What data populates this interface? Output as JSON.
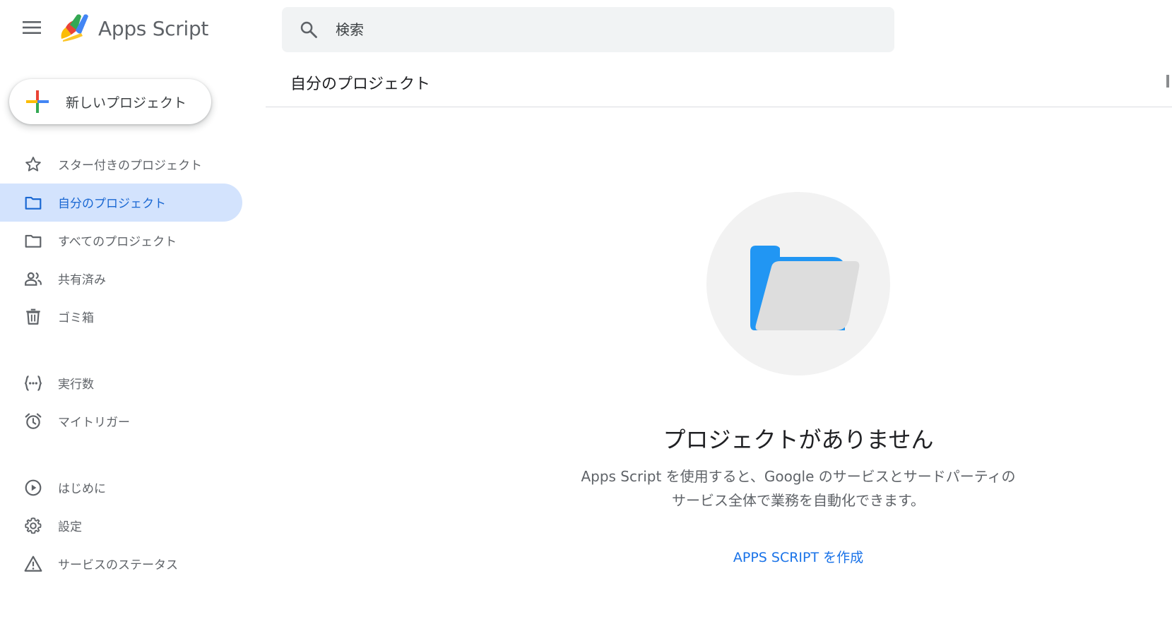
{
  "header": {
    "app_title": "Apps Script",
    "search_placeholder": "検索"
  },
  "new_project": {
    "label": "新しいプロジェクト"
  },
  "sidebar": {
    "items": [
      {
        "label": "スター付きのプロジェクト",
        "icon": "star-icon"
      },
      {
        "label": "自分のプロジェクト",
        "icon": "folder-icon",
        "active": true
      },
      {
        "label": "すべてのプロジェクト",
        "icon": "folder-icon"
      },
      {
        "label": "共有済み",
        "icon": "people-icon"
      },
      {
        "label": "ゴミ箱",
        "icon": "trash-icon"
      },
      {
        "label": "実行数",
        "icon": "executions-icon"
      },
      {
        "label": "マイトリガー",
        "icon": "alarm-icon"
      },
      {
        "label": "はじめに",
        "icon": "play-circle-icon"
      },
      {
        "label": "設定",
        "icon": "gear-icon"
      },
      {
        "label": "サービスのステータス",
        "icon": "warning-icon"
      }
    ]
  },
  "main": {
    "title": "自分のプロジェクト",
    "empty_state": {
      "title": "プロジェクトがありません",
      "description_line1": "Apps Script を使用すると、Google のサービスとサードパーティの",
      "description_line2": "サービス全体で業務を自動化できます。",
      "action_label": "APPS SCRIPT を作成",
      "illustration_icon": "folder-open-icon"
    }
  },
  "colors": {
    "accent": "#1a73e8",
    "active_bg": "#d3e3fd",
    "active_text": "#1967d2",
    "search_bg": "#f1f3f4",
    "folder_blue": "#2196f3"
  }
}
